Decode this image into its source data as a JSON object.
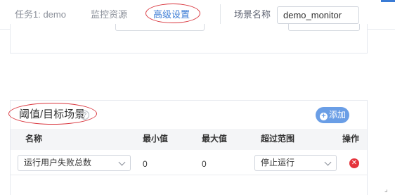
{
  "tabs": [
    {
      "label": "任务1: demo",
      "active": false
    },
    {
      "label": "监控资源",
      "active": false
    },
    {
      "label": "高级设置",
      "active": true
    }
  ],
  "scene": {
    "label": "场景名称",
    "value": "demo_monitor"
  },
  "threshold_section": {
    "title": "阈值/目标场景",
    "help_icon": "?",
    "add_label": "添加",
    "columns": [
      "名称",
      "最小值",
      "最大值",
      "超过范围",
      "操作"
    ],
    "rows": [
      {
        "name": "运行用户失败总数",
        "min": "0",
        "max": "0",
        "action": "停止运行",
        "delete_icon": "close-circle-icon"
      }
    ]
  },
  "colors": {
    "accent": "#3a7bd5",
    "add_button": "#6a9ee6",
    "delete": "#e5343c",
    "annotation": "#d9363e"
  }
}
